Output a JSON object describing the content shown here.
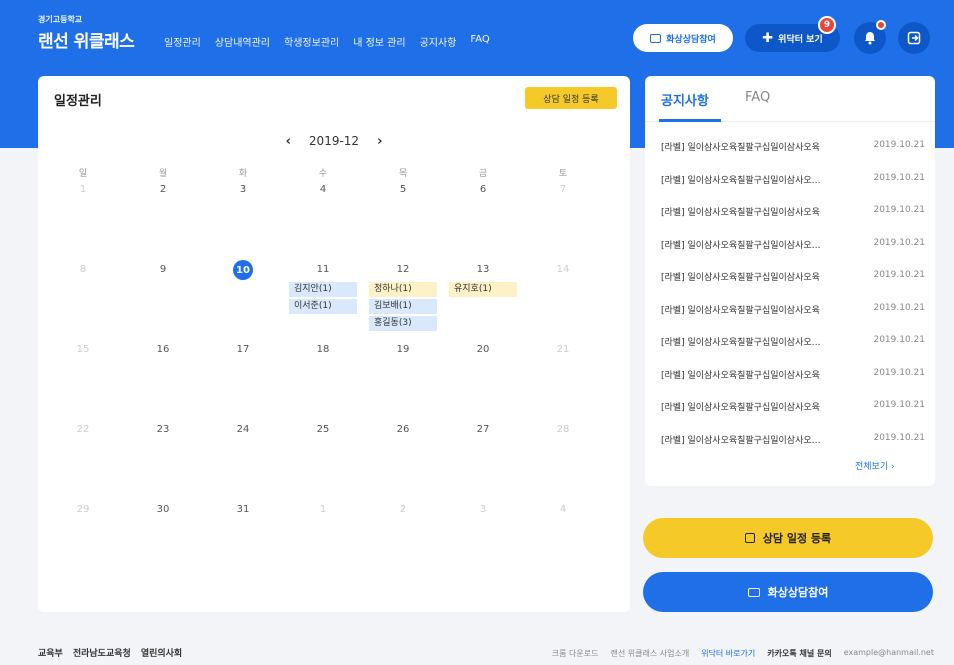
{
  "brand": {
    "school": "경기고등학교",
    "name": "랜선 위클래스"
  },
  "nav": [
    "일정관리",
    "상담내역관리",
    "학생정보관리",
    "내 정보 관리",
    "공지사항",
    "FAQ"
  ],
  "header": {
    "video_label": "화상상담참여",
    "widoctor_label": "위닥터 보기",
    "widoctor_badge": "9"
  },
  "calendar": {
    "title": "일정관리",
    "register_label": "상담 일정 등록",
    "month": "2019-12",
    "prev": "‹",
    "next": "›",
    "weekdays": [
      "일",
      "월",
      "화",
      "수",
      "목",
      "금",
      "토"
    ],
    "weeks": [
      [
        "1",
        "2",
        "3",
        "4",
        "5",
        "6",
        "7"
      ],
      [
        "8",
        "9",
        "10",
        "11",
        "12",
        "13",
        "14"
      ],
      [
        "15",
        "16",
        "17",
        "18",
        "19",
        "20",
        "21"
      ],
      [
        "22",
        "23",
        "24",
        "25",
        "26",
        "27",
        "28"
      ],
      [
        "29",
        "30",
        "31",
        "1",
        "2",
        "3",
        "4"
      ]
    ],
    "today": "10",
    "events": [
      {
        "label": "김지안(1)",
        "color": "blue"
      },
      {
        "label": "이서준(1)",
        "color": "blue"
      },
      {
        "label": "정하나(1)",
        "color": "yellow"
      },
      {
        "label": "김보배(1)",
        "color": "blue"
      },
      {
        "label": "홍길동(3)",
        "color": "blue"
      },
      {
        "label": "유지호(1)",
        "color": "yellow"
      }
    ]
  },
  "notice": {
    "tab_notice": "공지사항",
    "tab_faq": "FAQ",
    "items": [
      {
        "title": "[라벨] 일이삼사오육칠팔구십일이삼사오육",
        "date": "2019.10.21"
      },
      {
        "title": "[라벨] 일이삼사오육칠팔구십일이삼사오…",
        "date": "2019.10.21"
      },
      {
        "title": "[라벨] 일이삼사오육칠팔구십일이삼사오육",
        "date": "2019.10.21"
      },
      {
        "title": "[라벨] 일이삼사오육칠팔구십일이삼사오…",
        "date": "2019.10.21"
      },
      {
        "title": "[라벨] 일이삼사오육칠팔구십일이삼사오육",
        "date": "2019.10.21"
      },
      {
        "title": "[라벨] 일이삼사오육칠팔구십일이삼사오육",
        "date": "2019.10.21"
      },
      {
        "title": "[라벨] 일이삼사오육칠팔구십일이삼사오…",
        "date": "2019.10.21"
      },
      {
        "title": "[라벨] 일이삼사오육칠팔구십일이삼사오육",
        "date": "2019.10.21"
      },
      {
        "title": "[라벨] 일이삼사오육칠팔구십일이삼사오육",
        "date": "2019.10.21"
      },
      {
        "title": "[라벨] 일이삼사오육칠팔구십일이삼사오…",
        "date": "2019.10.21"
      }
    ],
    "more_label": "전체보기 ›"
  },
  "actions": {
    "register_label": "상담 일정 등록",
    "video_label": "화상상담참여"
  },
  "footer": {
    "logos": [
      "교육부",
      "전라남도교육청",
      "열린의사회"
    ],
    "links": [
      "크롬 다운로드",
      "랜선 위클래스 사업소개",
      "위닥터 바로가기",
      "카카오톡 채널 문의",
      "example@hanmail.net"
    ]
  },
  "colors": {
    "primary": "#1e6fe8",
    "accent": "#f5c928",
    "badge": "#e8453c"
  }
}
